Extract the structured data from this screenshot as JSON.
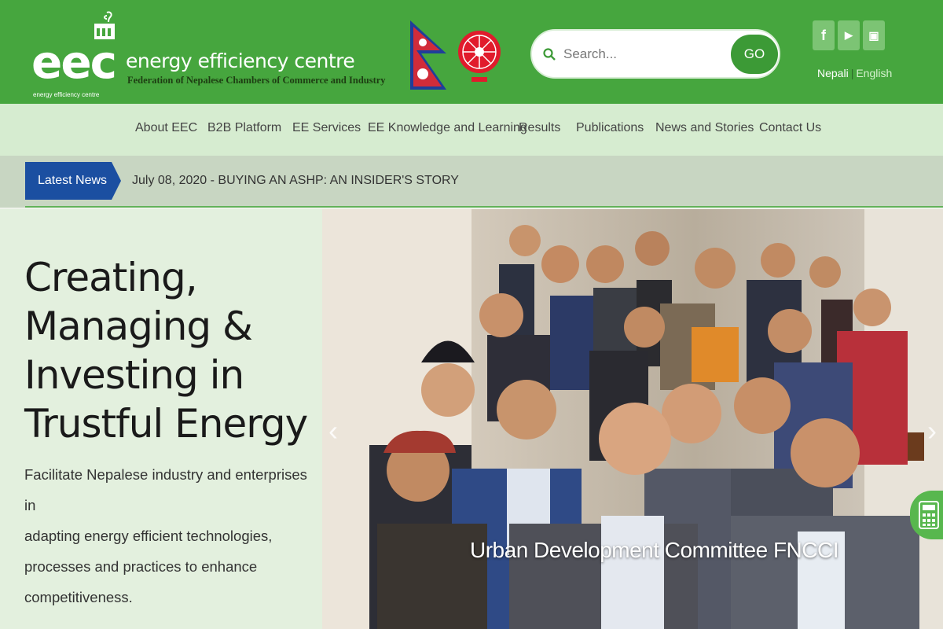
{
  "header": {
    "logo_mark": "eec",
    "logo_tagline": "energy efficiency centre",
    "org_title": "energy efficiency centre",
    "org_subtitle": "Federation of Nepalese Chambers of Commerce and Industry",
    "search": {
      "placeholder": "Search...",
      "button_label": "GO"
    },
    "social": [
      {
        "icon": "facebook-icon",
        "glyph": "f"
      },
      {
        "icon": "youtube-icon",
        "glyph": "▶"
      },
      {
        "icon": "calculator-icon",
        "glyph": "▣"
      }
    ],
    "languages": {
      "nepali": "Nepali",
      "separator": "|",
      "english": "English"
    }
  },
  "nav": {
    "items": [
      {
        "label": "About EEC"
      },
      {
        "label": "B2B Platform"
      },
      {
        "label": "EE Services"
      },
      {
        "label": "EE Knowledge and Learning"
      },
      {
        "label": "Results"
      },
      {
        "label": "Publications"
      },
      {
        "label": "News and Stories"
      },
      {
        "label": "Contact Us"
      }
    ]
  },
  "ticker": {
    "badge": "Latest News",
    "headline": "July 08, 2020 - BUYING AN ASHP: AN INSIDER'S STORY"
  },
  "hero": {
    "title_lines": [
      "Creating,",
      "Managing &",
      "Investing in",
      "Trustful Energy"
    ],
    "description_lines": [
      "Facilitate Nepalese industry and enterprises in",
      "adapting energy efficient technologies,",
      "processes and practices to enhance",
      "competitiveness."
    ],
    "slide_caption": "Urban Development Committee FNCCI",
    "prev_glyph": "‹",
    "next_glyph": "›"
  },
  "colors": {
    "header_green": "#46a63e",
    "nav_bg": "#d6ecd0",
    "ticker_bg": "#c8d6c2",
    "badge_blue": "#1b4fa1",
    "hero_bg": "#e3f0de"
  }
}
